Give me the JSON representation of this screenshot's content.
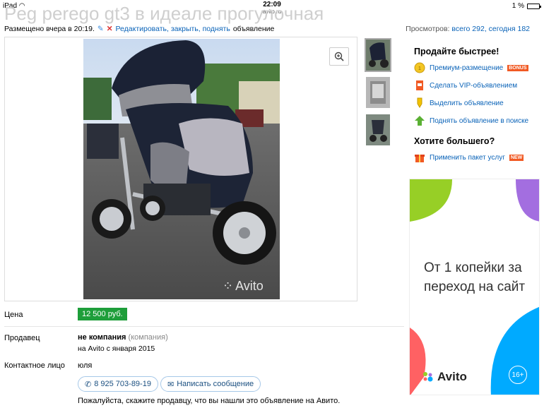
{
  "status_bar": {
    "device": "iPad",
    "time": "22:09",
    "url": "avito.ru",
    "battery": "1 %"
  },
  "listing": {
    "title": "Peg perego gt3 в идеале прогулочная",
    "posted": "Размещено вчера в 20:19.",
    "edit_link": "Редактировать, закрыть, поднять",
    "edit_suffix": "объявление",
    "views_label": "Просмотров:",
    "views_value": "всего 292, сегодня 182",
    "watermark": "Avito"
  },
  "sidebar": {
    "heading1": "Продайте быстрее!",
    "items": [
      {
        "label": "Премиум-размещение",
        "badge": "BONUS",
        "icon": "premium-coin-icon"
      },
      {
        "label": "Сделать VIP-объявлением",
        "icon": "vip-icon"
      },
      {
        "label": "Выделить объявление",
        "icon": "highlight-icon"
      },
      {
        "label": "Поднять объявление в поиске",
        "icon": "up-arrow-icon"
      }
    ],
    "heading2": "Хотите большего?",
    "package": {
      "label": "Применить пакет услуг",
      "badge": "NEW",
      "icon": "gift-icon"
    }
  },
  "ad": {
    "text": "От 1 копейки за переход на сайт",
    "logo": "Avito",
    "age": "16+"
  },
  "details": {
    "price_label": "Цена",
    "price": "12 500 руб.",
    "seller_label": "Продавец",
    "seller_name": "не компания",
    "seller_type": "(компания)",
    "seller_since": "на Avito с января 2015",
    "contact_label": "Контактное лицо",
    "contact_name": "юля",
    "phone": "8 925 703-89-19",
    "message_button": "Написать сообщение",
    "notice": "Пожалуйста, скажите продавцу, что вы нашли это объявление на Авито."
  },
  "colors": {
    "link": "#0a63b8",
    "price_bg": "#1e9e3a",
    "badge": "#f15a24"
  }
}
